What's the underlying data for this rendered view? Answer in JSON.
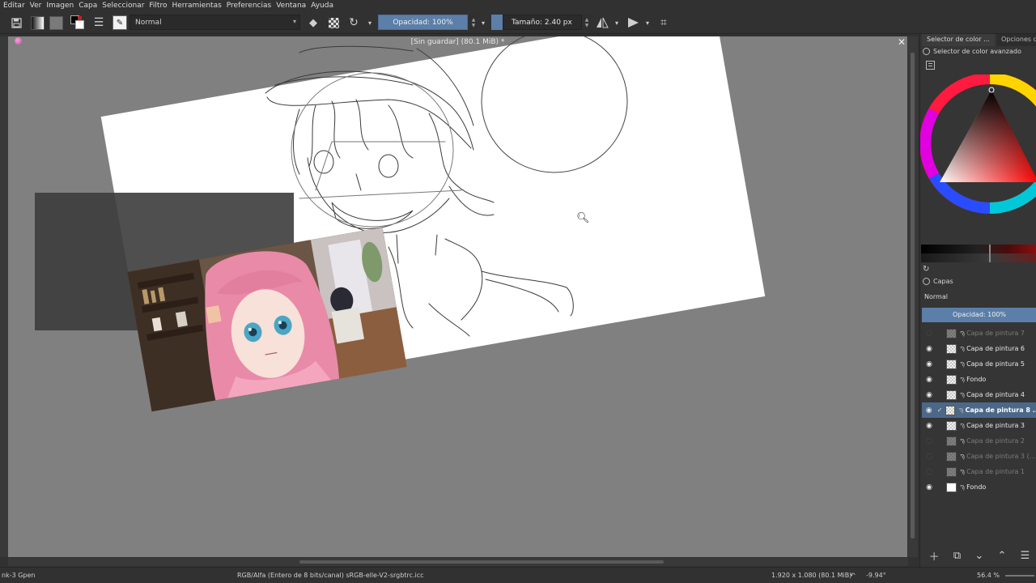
{
  "menu": [
    "Editar",
    "Ver",
    "Imagen",
    "Capa",
    "Seleccionar",
    "Filtro",
    "Herramientas",
    "Preferencias",
    "Ventana",
    "Ayuda"
  ],
  "toolbar": {
    "blend_mode": "Normal",
    "opacity_label": "Opacidad: 100%",
    "size_label": "Tamaño: 2.40 px"
  },
  "document": {
    "title": "[Sin guardar]  (80.1 MiB) *",
    "close_glyph": "✕"
  },
  "dock": {
    "tabs": [
      "Selector de color ...",
      "Opciones de"
    ],
    "color_panel_title": "Selector de color avanzado",
    "layers_panel_title": "Capas",
    "layer_blend": "Normal",
    "layer_opacity": "Opacidad:  100%"
  },
  "layers": [
    {
      "name": "Capa de pintura 7",
      "visible": false,
      "dim": true,
      "thumb": "checker"
    },
    {
      "name": "Capa de pintura 6",
      "visible": true,
      "dim": false,
      "thumb": "checker"
    },
    {
      "name": "Capa de pintura 5",
      "visible": true,
      "dim": false,
      "thumb": "checker"
    },
    {
      "name": "Fondo",
      "visible": true,
      "dim": false,
      "thumb": "checker"
    },
    {
      "name": "Capa de pintura 4",
      "visible": true,
      "dim": false,
      "thumb": "checker"
    },
    {
      "name": "Capa de pintura 8 ...",
      "visible": true,
      "dim": false,
      "thumb": "checker",
      "selected": true
    },
    {
      "name": "Capa de pintura 3",
      "visible": true,
      "dim": false,
      "thumb": "checker"
    },
    {
      "name": "Capa de pintura 2",
      "visible": false,
      "dim": true,
      "thumb": "checker"
    },
    {
      "name": "Capa de pintura 3 (...",
      "visible": false,
      "dim": true,
      "thumb": "checker"
    },
    {
      "name": "Capa de pintura 1",
      "visible": false,
      "dim": true,
      "thumb": "checker"
    },
    {
      "name": "Fondo",
      "visible": true,
      "dim": false,
      "thumb": "white"
    }
  ],
  "status": {
    "brush": "nk-3 Gpen",
    "color_space": "RGB/Alfa (Entero de 8 bits/canal)  sRGB-elle-V2-srgbtrc.icc",
    "dimensions": "1.920 x 1.080 (80.1 MiB)",
    "rotation": "-9.94°",
    "zoom": "56.4 %"
  },
  "colors": {
    "accent": "#5b7fa8",
    "panel_bg": "#353535",
    "canvas_bg": "#808080"
  },
  "icons": [
    "save-icon",
    "gradient-icon",
    "pattern-icon",
    "color-swap-icon",
    "brush-settings-icon",
    "brush-preset-icon",
    "eraser-icon",
    "alpha-lock-icon",
    "reload-icon",
    "mirror-horizontal-icon",
    "mirror-vertical-icon",
    "wrap-icon",
    "zoom-cursor-icon",
    "add-layer-icon",
    "duplicate-layer-icon",
    "move-down-icon",
    "move-up-icon",
    "layer-properties-icon"
  ]
}
